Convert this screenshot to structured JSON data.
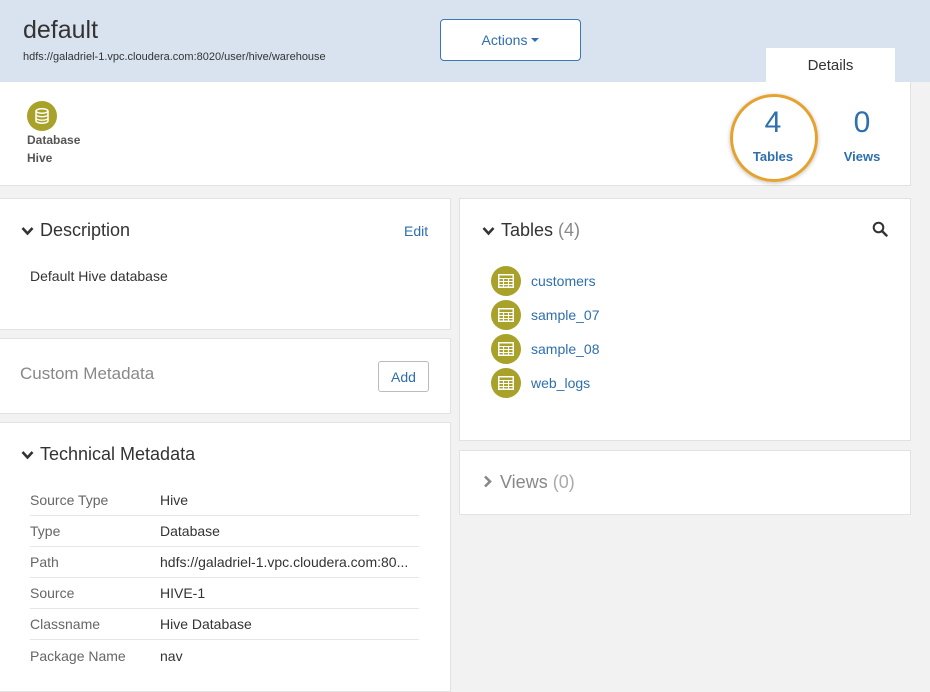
{
  "header": {
    "title": "default",
    "path": "hdfs://galadriel-1.vpc.cloudera.com:8020/user/hive/warehouse",
    "actions_label": "Actions",
    "details_tab": "Details"
  },
  "summary": {
    "entity_type": "Database",
    "source": "Hive",
    "tables_count": "4",
    "tables_label": "Tables",
    "views_count": "0",
    "views_label": "Views"
  },
  "description": {
    "title": "Description",
    "edit_label": "Edit",
    "text": "Default Hive database"
  },
  "custom_metadata": {
    "title": "Custom Metadata",
    "add_label": "Add"
  },
  "technical_metadata": {
    "title": "Technical Metadata",
    "rows": [
      {
        "key": "Source Type",
        "value": "Hive"
      },
      {
        "key": "Type",
        "value": "Database"
      },
      {
        "key": "Path",
        "value": "hdfs://galadriel-1.vpc.cloudera.com:80..."
      },
      {
        "key": "Source",
        "value": "HIVE-1"
      },
      {
        "key": "Classname",
        "value": "Hive Database"
      },
      {
        "key": "Package Name",
        "value": "nav"
      }
    ]
  },
  "tables_panel": {
    "title": "Tables",
    "count": "(4)",
    "items": [
      "customers",
      "sample_07",
      "sample_08",
      "web_logs"
    ]
  },
  "views_panel": {
    "title": "Views",
    "count": "(0)"
  },
  "colors": {
    "accent": "#2e6fad",
    "icon_olive": "#a8a22a",
    "highlight": "#e6a22e",
    "header_bg": "#d8e3ef"
  }
}
